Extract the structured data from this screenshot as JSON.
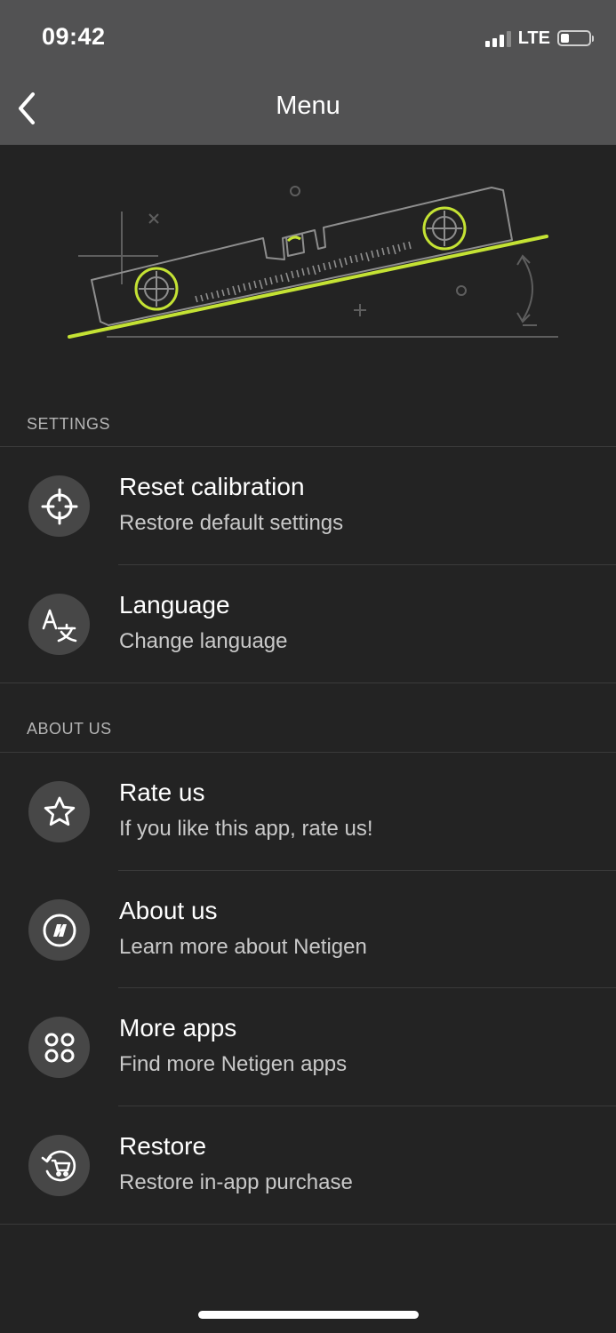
{
  "status_bar": {
    "time": "09:42",
    "network": "LTE"
  },
  "nav": {
    "title": "Menu",
    "back_icon": "chevron-left-icon"
  },
  "sections": {
    "settings": {
      "header": "SETTINGS",
      "items": [
        {
          "title": "Reset calibration",
          "subtitle": "Restore default settings",
          "icon": "crosshair-icon"
        },
        {
          "title": "Language",
          "subtitle": "Change language",
          "icon": "translate-icon"
        }
      ]
    },
    "about": {
      "header": "ABOUT US",
      "items": [
        {
          "title": "Rate us",
          "subtitle": "If you like this app, rate us!",
          "icon": "star-icon"
        },
        {
          "title": "About us",
          "subtitle": "Learn more about Netigen",
          "icon": "netigen-logo-icon"
        },
        {
          "title": "More apps",
          "subtitle": "Find more Netigen apps",
          "icon": "apps-grid-icon"
        },
        {
          "title": "Restore",
          "subtitle": "Restore in-app purchase",
          "icon": "restore-cart-icon"
        }
      ]
    }
  },
  "colors": {
    "background": "#232323",
    "header": "#525253",
    "accent": "#c4e234",
    "icon_circle": "#474747"
  }
}
